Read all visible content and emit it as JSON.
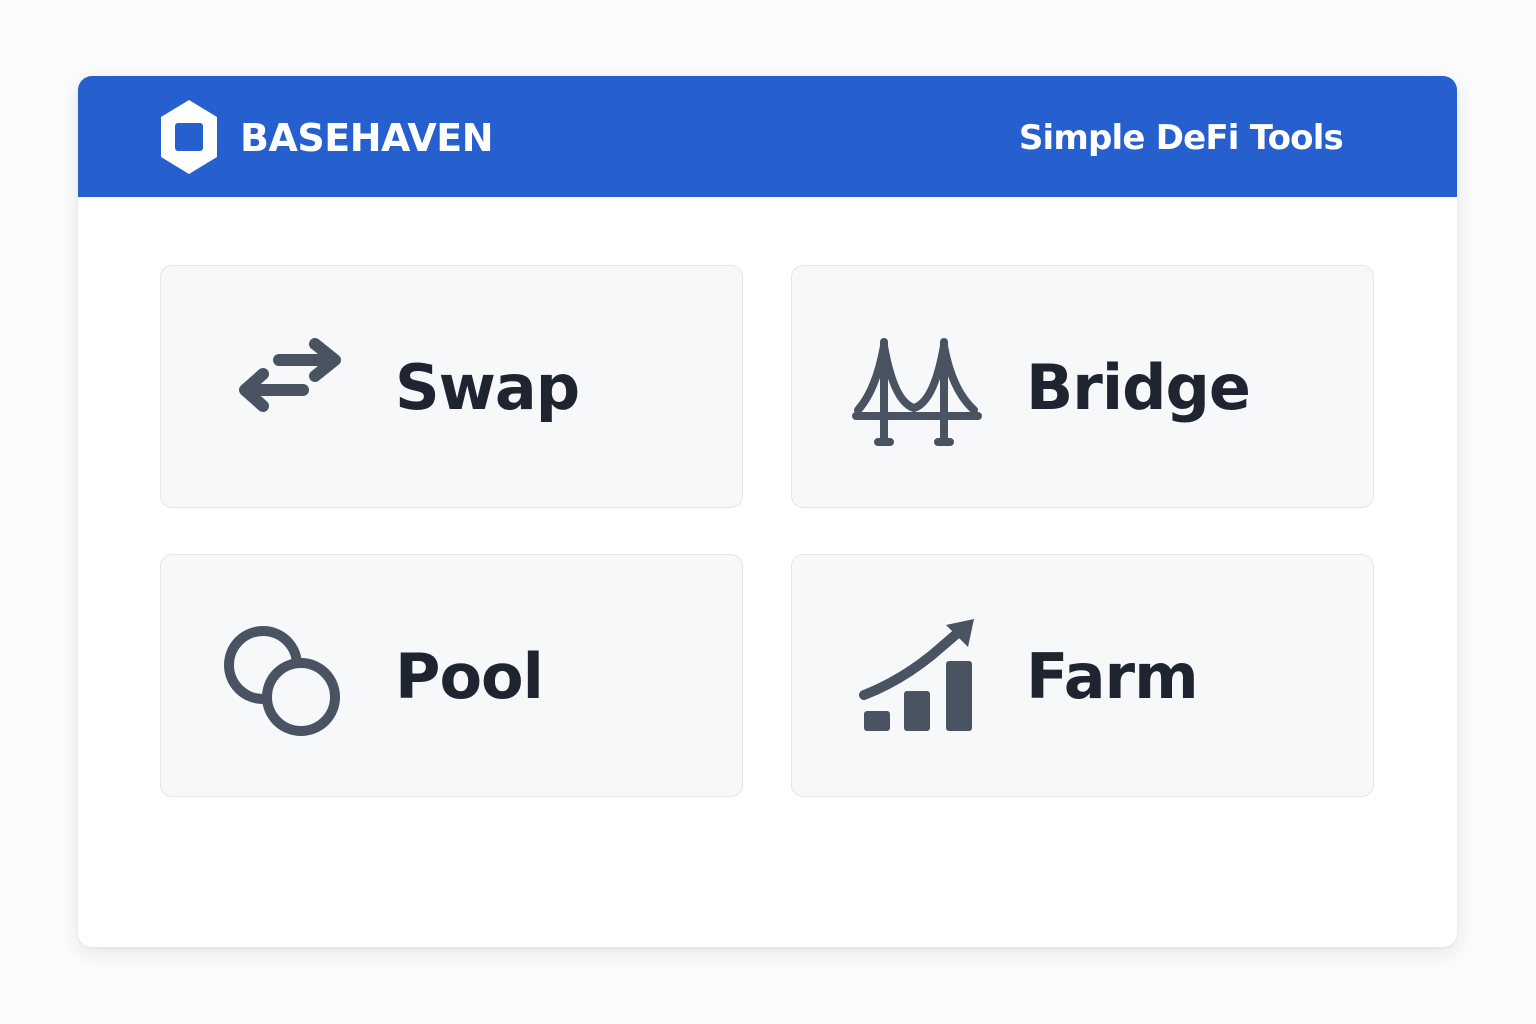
{
  "header": {
    "brand": "BASEHAVEN",
    "tagline": "Simple DeFi Tools",
    "logo_icon": "hexagon-logo-icon"
  },
  "colors": {
    "header_bg": "#2660cf",
    "card_bg": "#f7f8fa",
    "icon": "#4a5361",
    "label": "#1f2530"
  },
  "tools": [
    {
      "label": "Swap",
      "icon": "swap-arrows-icon"
    },
    {
      "label": "Bridge",
      "icon": "bridge-icon"
    },
    {
      "label": "Pool",
      "icon": "overlapping-circles-icon"
    },
    {
      "label": "Farm",
      "icon": "growth-chart-icon"
    }
  ]
}
